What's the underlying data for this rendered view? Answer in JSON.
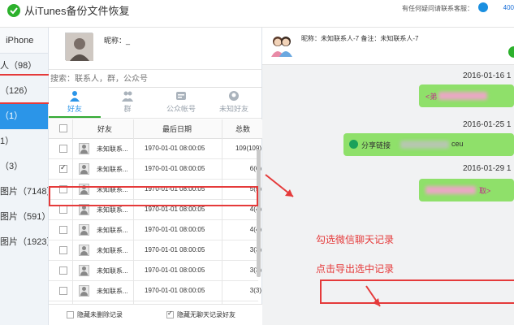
{
  "app": {
    "title": "从iTunes备份文件恢复",
    "help_text": "有任何疑问请联系客服：",
    "qq_number": "400"
  },
  "sidebar": {
    "header": "iPhone",
    "items": [
      {
        "label": "人（98）",
        "active": false
      },
      {
        "label": "（126）",
        "active": false
      },
      {
        "label": "（1）",
        "active": true
      },
      {
        "label": "1）",
        "active": false
      },
      {
        "label": "（3）",
        "active": false
      },
      {
        "label": "图片（7148）",
        "active": false
      },
      {
        "label": "图片（591）",
        "active": false
      },
      {
        "label": "图片（1923）",
        "active": false
      }
    ]
  },
  "profile": {
    "nickname_label": "昵称：_"
  },
  "search": {
    "placeholder": "搜索：联系人，群，公众号"
  },
  "tabs": [
    {
      "label": "好友",
      "icon": "person-icon",
      "active": true
    },
    {
      "label": "群",
      "icon": "group-icon",
      "active": false
    },
    {
      "label": "公众帐号",
      "icon": "official-account-icon",
      "active": false
    },
    {
      "label": "未知好友",
      "icon": "unknown-friend-icon",
      "active": false
    }
  ],
  "table": {
    "headers": [
      "好友",
      "最后日期",
      "总数"
    ],
    "rows": [
      {
        "name": "未知联系...",
        "date": "1970-01-01 08:00:05",
        "count": "109(109)",
        "checked": false
      },
      {
        "name": "未知联系...",
        "date": "1970-01-01 08:00:05",
        "count": "6(6)",
        "checked": true
      },
      {
        "name": "未知联系...",
        "date": "1970-01-01 08:00:05",
        "count": "5(5)",
        "checked": false
      },
      {
        "name": "未知联系...",
        "date": "1970-01-01 08:00:05",
        "count": "4(4)",
        "checked": false
      },
      {
        "name": "未知联系...",
        "date": "1970-01-01 08:00:05",
        "count": "4(4)",
        "checked": false
      },
      {
        "name": "未知联系...",
        "date": "1970-01-01 08:00:05",
        "count": "3(3)",
        "checked": false
      },
      {
        "name": "未知联系...",
        "date": "1970-01-01 08:00:05",
        "count": "3(3)",
        "checked": false
      },
      {
        "name": "未知联系...",
        "date": "1970-01-01 08:00:05",
        "count": "3(3)",
        "checked": false
      }
    ]
  },
  "footer": {
    "hide_deleted_label": "隐藏未删除记录",
    "hide_deleted_checked": false,
    "hide_no_chat_label": "隐藏无聊天记录好友",
    "hide_no_chat_checked": true
  },
  "chat": {
    "header_text": "昵称：未知联系人-7   备注：未知联系人-7",
    "messages": [
      {
        "date": "2016-01-16 1",
        "text": "<弟"
      },
      {
        "date": "2016-01-25 1",
        "text": "分享链接",
        "suffix": "ceu"
      },
      {
        "date": "2016-01-29 1",
        "text": "取>"
      }
    ]
  },
  "annotations": {
    "select": "勾选微信聊天记录",
    "export": "点击导出选中记录"
  },
  "colors": {
    "accent": "#2b95e8",
    "highlight": "#e53a3a",
    "bubble": "#8fe06a",
    "tab_underline": "#33aa33"
  }
}
